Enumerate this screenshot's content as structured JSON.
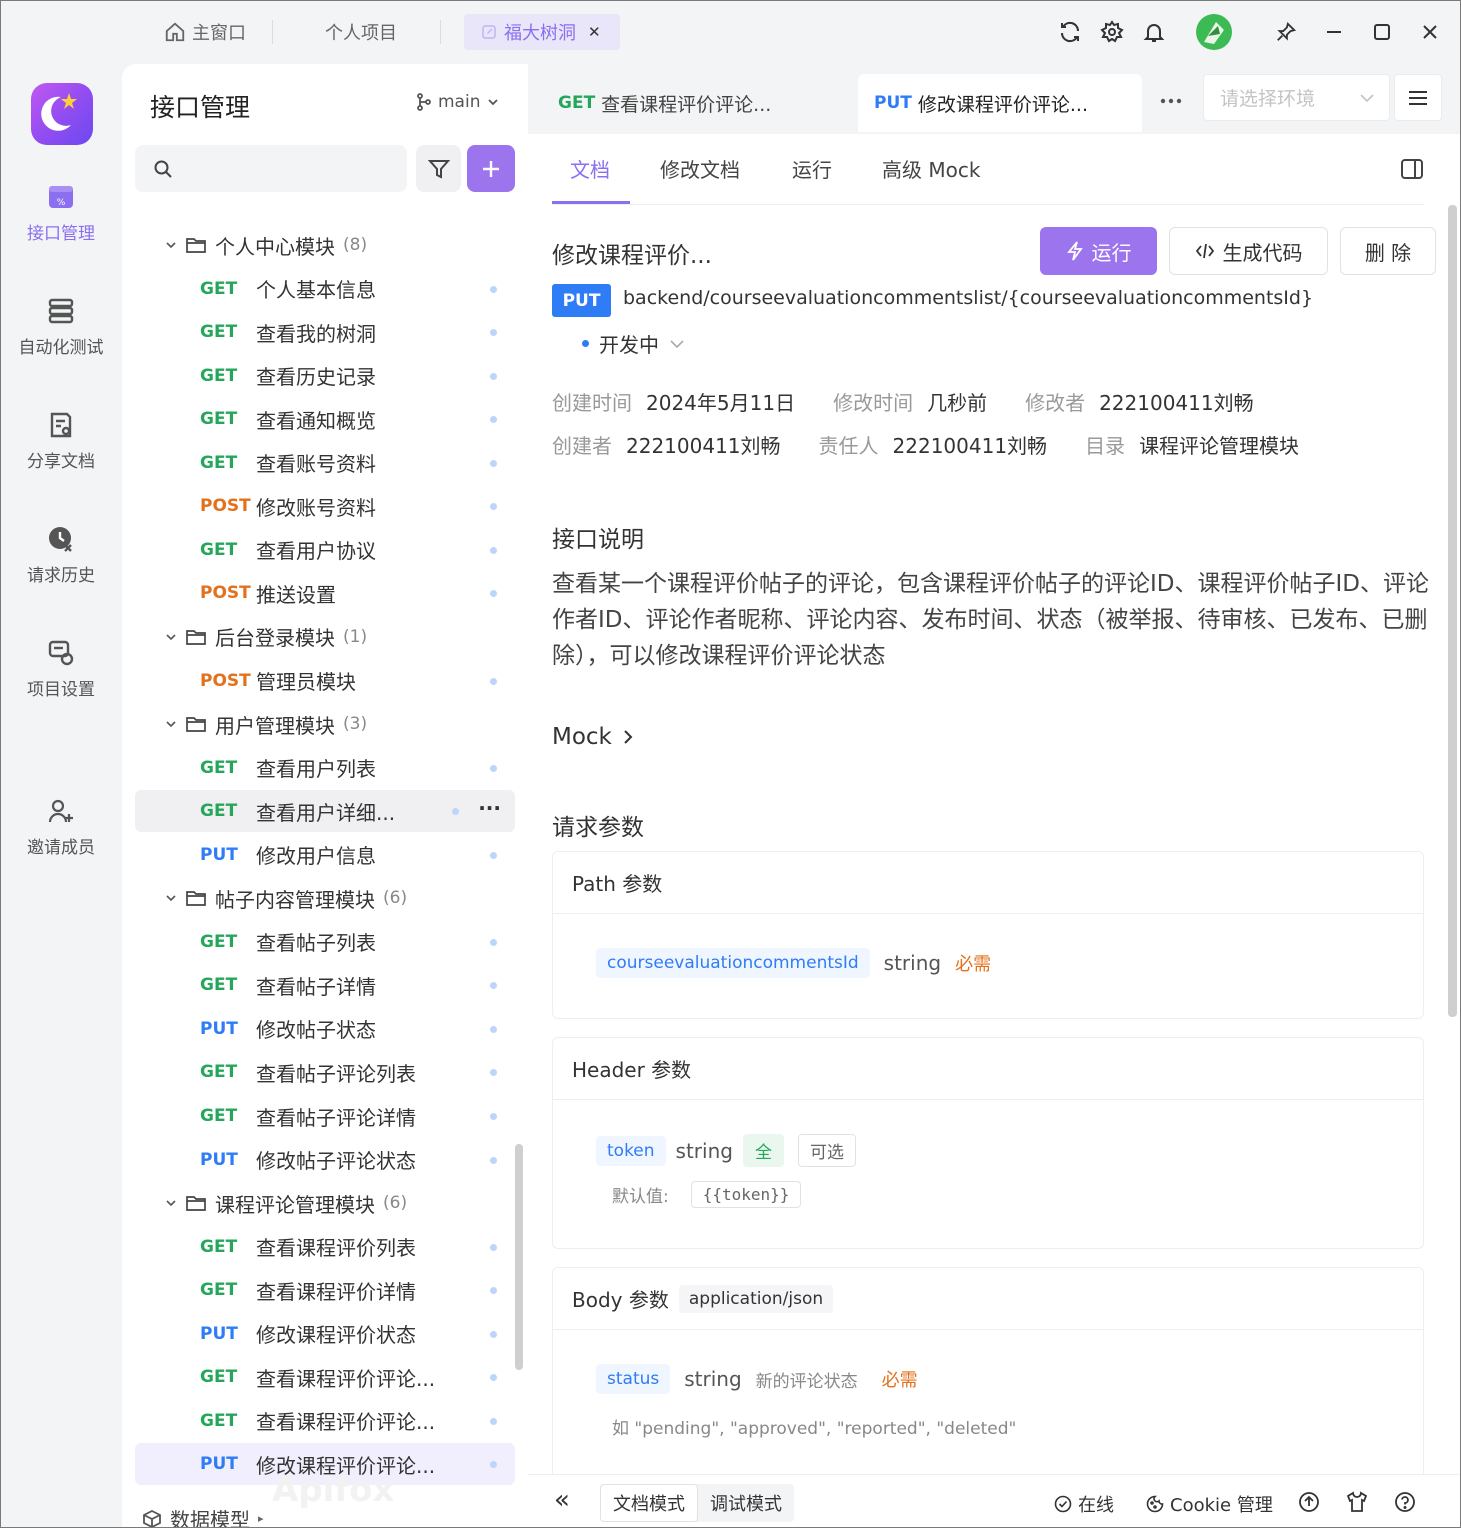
{
  "topbar": {
    "tabs": [
      {
        "label": "主窗口",
        "icon": "home-icon"
      },
      {
        "label": "个人项目"
      },
      {
        "label": "福大树洞",
        "icon": "link-icon",
        "close": "✕"
      }
    ]
  },
  "nav": {
    "items": [
      {
        "label": "接口管理",
        "icon": "api-icon",
        "active": true
      },
      {
        "label": "自动化测试",
        "icon": "stack-icon"
      },
      {
        "label": "分享文档",
        "icon": "share-doc-icon"
      },
      {
        "label": "请求历史",
        "icon": "history-icon"
      },
      {
        "label": "项目设置",
        "icon": "settings-doc-icon"
      },
      {
        "label": "邀请成员",
        "icon": "invite-icon"
      }
    ]
  },
  "left_panel": {
    "title": "接口管理",
    "branch": "main",
    "data_model": "数据模型",
    "watermark": "Apifox",
    "tree": [
      {
        "type": "folder",
        "name": "个人中心模块",
        "count": "(8)"
      },
      {
        "type": "api",
        "method": "GET",
        "name": "个人基本信息"
      },
      {
        "type": "api",
        "method": "GET",
        "name": "查看我的树洞"
      },
      {
        "type": "api",
        "method": "GET",
        "name": "查看历史记录"
      },
      {
        "type": "api",
        "method": "GET",
        "name": "查看通知概览"
      },
      {
        "type": "api",
        "method": "GET",
        "name": "查看账号资料"
      },
      {
        "type": "api",
        "method": "POST",
        "name": "修改账号资料"
      },
      {
        "type": "api",
        "method": "GET",
        "name": "查看用户协议"
      },
      {
        "type": "api",
        "method": "POST",
        "name": "推送设置"
      },
      {
        "type": "folder",
        "name": "后台登录模块",
        "count": "(1)"
      },
      {
        "type": "api",
        "method": "POST",
        "name": "管理员模块"
      },
      {
        "type": "folder",
        "name": "用户管理模块",
        "count": "(3)"
      },
      {
        "type": "api",
        "method": "GET",
        "name": "查看用户列表"
      },
      {
        "type": "api",
        "method": "GET",
        "name": "查看用户详细...",
        "hover": true,
        "more": "···"
      },
      {
        "type": "api",
        "method": "PUT",
        "name": "修改用户信息"
      },
      {
        "type": "folder",
        "name": "帖子内容管理模块",
        "count": "(6)"
      },
      {
        "type": "api",
        "method": "GET",
        "name": "查看帖子列表"
      },
      {
        "type": "api",
        "method": "GET",
        "name": "查看帖子详情"
      },
      {
        "type": "api",
        "method": "PUT",
        "name": "修改帖子状态"
      },
      {
        "type": "api",
        "method": "GET",
        "name": "查看帖子评论列表"
      },
      {
        "type": "api",
        "method": "GET",
        "name": "查看帖子评论详情"
      },
      {
        "type": "api",
        "method": "PUT",
        "name": "修改帖子评论状态"
      },
      {
        "type": "folder",
        "name": "课程评论管理模块",
        "count": "(6)"
      },
      {
        "type": "api",
        "method": "GET",
        "name": "查看课程评价列表"
      },
      {
        "type": "api",
        "method": "GET",
        "name": "查看课程评价详情"
      },
      {
        "type": "api",
        "method": "PUT",
        "name": "修改课程评价状态"
      },
      {
        "type": "api",
        "method": "GET",
        "name": "查看课程评价评论..."
      },
      {
        "type": "api",
        "method": "GET",
        "name": "查看课程评价评论..."
      },
      {
        "type": "api",
        "method": "PUT",
        "name": "修改课程评价评论...",
        "selected": true
      }
    ]
  },
  "right_tabs": [
    {
      "method": "GET",
      "label": "查看课程评价评论..."
    },
    {
      "method": "PUT",
      "label": "修改课程评价评论..."
    }
  ],
  "env_placeholder": "请选择环境",
  "doc_tabs": [
    "文档",
    "修改文档",
    "运行",
    "高级 Mock"
  ],
  "doc": {
    "title": "修改课程评价...",
    "run_label": "运行",
    "gencode_label": "生成代码",
    "delete_label": "删 除",
    "method": "PUT",
    "path": "backend/courseevaluationcommentslist/{courseevaluationcommentsId}",
    "status": "开发中",
    "meta1": [
      {
        "k": "创建时间",
        "v": "2024年5月11日"
      },
      {
        "k": "修改时间",
        "v": "几秒前"
      },
      {
        "k": "修改者",
        "v": "222100411刘畅"
      }
    ],
    "meta2": [
      {
        "k": "创建者",
        "v": "222100411刘畅"
      },
      {
        "k": "责任人",
        "v": "222100411刘畅"
      },
      {
        "k": "目录",
        "v": "课程评论管理模块"
      }
    ],
    "desc_title": "接口说明",
    "desc": "查看某一个课程评价帖子的评论，包含课程评价帖子的评论ID、课程评价帖子ID、评论作者ID、评论作者昵称、评论内容、发布时间、状态（被举报、待审核、已发布、已删除），可以修改课程评价评论状态",
    "mock_title": "Mock",
    "params_title": "请求参数",
    "path_params": {
      "title": "Path 参数",
      "name": "courseevaluationcommentsId",
      "type": "string",
      "required": "必需"
    },
    "header_params": {
      "title": "Header 参数",
      "name": "token",
      "type": "string",
      "badge": "全",
      "optional": "可选",
      "default_label": "默认值:",
      "default_value": "{{token}}"
    },
    "body_params": {
      "title": "Body 参数",
      "mime": "application/json",
      "name": "status",
      "type": "string",
      "desc": "新的评论状态",
      "required": "必需",
      "example": "如 \"pending\", \"approved\", \"reported\", \"deleted\""
    }
  },
  "bottom": {
    "collapse": "«",
    "modes": [
      "文档模式",
      "调试模式"
    ],
    "online": "在线",
    "cookie": "Cookie 管理"
  },
  "colors": {
    "accent": "#8b6ff0",
    "get": "#26a65b",
    "post": "#e3701b",
    "put": "#2e7cf6"
  }
}
